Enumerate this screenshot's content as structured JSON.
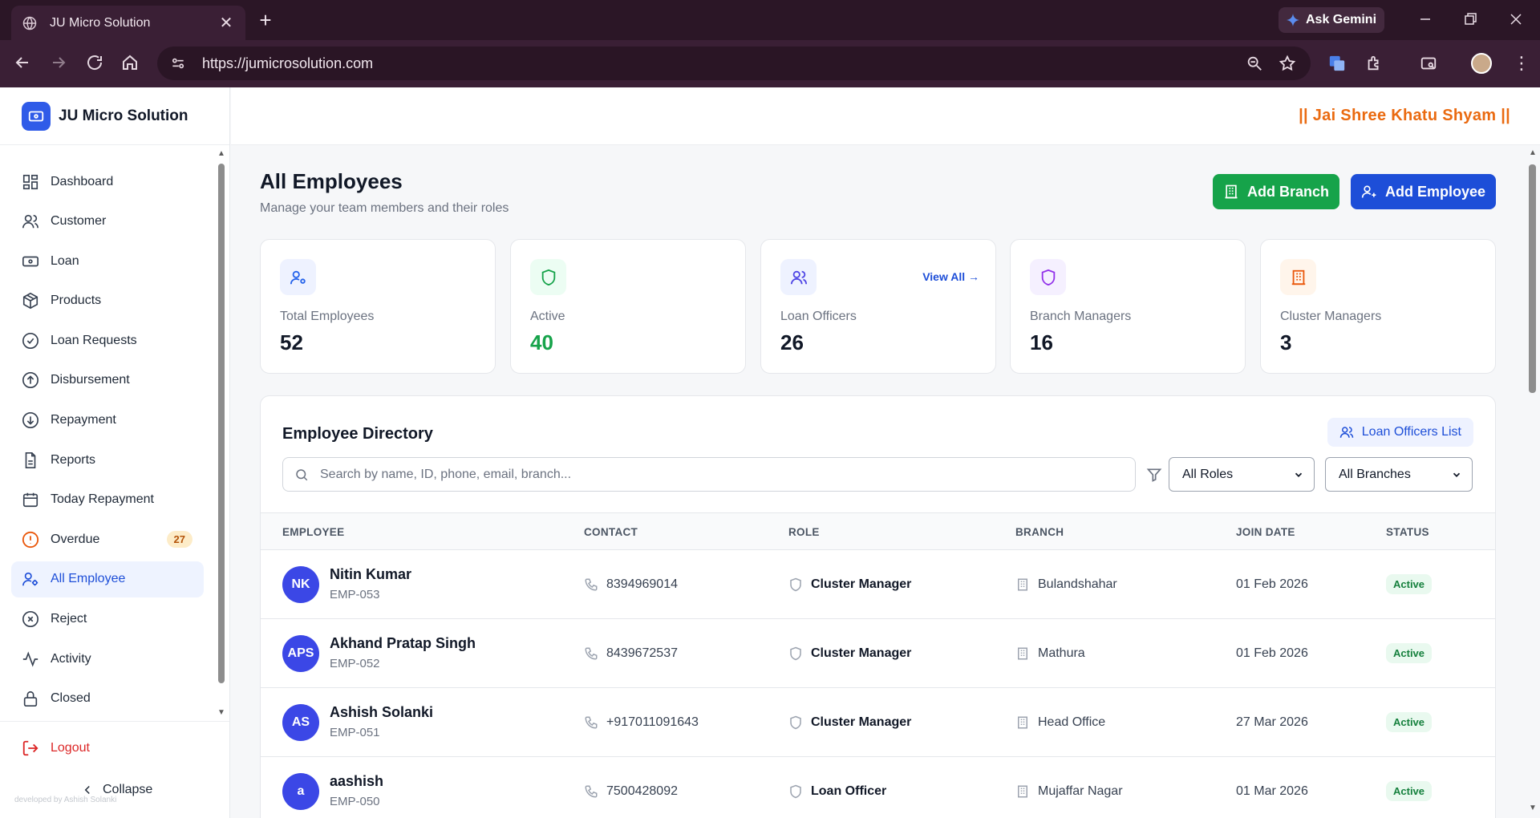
{
  "browser": {
    "tab_title": "JU Micro Solution",
    "url": "https://jumicrosolution.com",
    "ask_gemini": "Ask Gemini",
    "new_tab": "+",
    "close_tab": "✕"
  },
  "sidebar": {
    "brand": "JU Micro Solution",
    "items": [
      {
        "label": "Dashboard",
        "icon": "dashboard-icon"
      },
      {
        "label": "Customer",
        "icon": "users-icon"
      },
      {
        "label": "Loan",
        "icon": "banknote-icon"
      },
      {
        "label": "Products",
        "icon": "package-icon"
      },
      {
        "label": "Loan Requests",
        "icon": "check-circle-icon"
      },
      {
        "label": "Disbursement",
        "icon": "arrow-up-circle-icon"
      },
      {
        "label": "Repayment",
        "icon": "arrow-down-circle-icon"
      },
      {
        "label": "Reports",
        "icon": "file-icon"
      },
      {
        "label": "Today Repayment",
        "icon": "calendar-icon"
      },
      {
        "label": "Overdue",
        "icon": "alert-circle-icon",
        "badge": "27"
      },
      {
        "label": "All Employee",
        "icon": "user-cog-icon",
        "active": true
      },
      {
        "label": "Reject",
        "icon": "x-circle-icon"
      },
      {
        "label": "Activity",
        "icon": "activity-icon"
      },
      {
        "label": "Closed",
        "icon": "lock-icon"
      }
    ],
    "logout": "Logout",
    "collapse": "Collapse",
    "developed_by": "developed by Ashish Solanki"
  },
  "header": {
    "slogan": "|| Jai Shree Khatu Shyam ||"
  },
  "page": {
    "title": "All Employees",
    "subtitle": "Manage your team members and their roles",
    "add_branch": "Add Branch",
    "add_employee": "Add Employee"
  },
  "stats": [
    {
      "label": "Total Employees",
      "value": "52",
      "color": "#2563eb",
      "bg": "#eef2ff"
    },
    {
      "label": "Active",
      "value": "40",
      "color": "#16a34a",
      "bg": "#ecfdf3"
    },
    {
      "label": "Loan Officers",
      "value": "26",
      "color": "#4f46e5",
      "bg": "#eef2ff",
      "link": "View All →"
    },
    {
      "label": "Branch Managers",
      "value": "16",
      "color": "#9333ea",
      "bg": "#f5f0ff"
    },
    {
      "label": "Cluster Managers",
      "value": "3",
      "color": "#ea580c",
      "bg": "#fff5eb"
    }
  ],
  "directory": {
    "title": "Employee Directory",
    "loan_officers_list": "Loan Officers List",
    "search_placeholder": "Search by name, ID, phone, email, branch...",
    "roles_filter": "All Roles",
    "branches_filter": "All Branches",
    "columns": [
      "EMPLOYEE",
      "CONTACT",
      "ROLE",
      "BRANCH",
      "JOIN DATE",
      "STATUS"
    ],
    "rows": [
      {
        "initials": "NK",
        "name": "Nitin Kumar",
        "id": "EMP-053",
        "phone": "8394969014",
        "role": "Cluster Manager",
        "branch": "Bulandshahar",
        "join": "01 Feb 2026",
        "status": "Active"
      },
      {
        "initials": "APS",
        "name": "Akhand Pratap Singh",
        "id": "EMP-052",
        "phone": "8439672537",
        "role": "Cluster Manager",
        "branch": "Mathura",
        "join": "01 Feb 2026",
        "status": "Active"
      },
      {
        "initials": "AS",
        "name": "Ashish Solanki",
        "id": "EMP-051",
        "phone": "+917011091643",
        "role": "Cluster Manager",
        "branch": "Head Office",
        "join": "27 Mar 2026",
        "status": "Active"
      },
      {
        "initials": "a",
        "name": "aashish",
        "id": "EMP-050",
        "phone": "7500428092",
        "role": "Loan Officer",
        "branch": "Mujaffar Nagar",
        "join": "01 Mar 2026",
        "status": "Active"
      }
    ]
  }
}
